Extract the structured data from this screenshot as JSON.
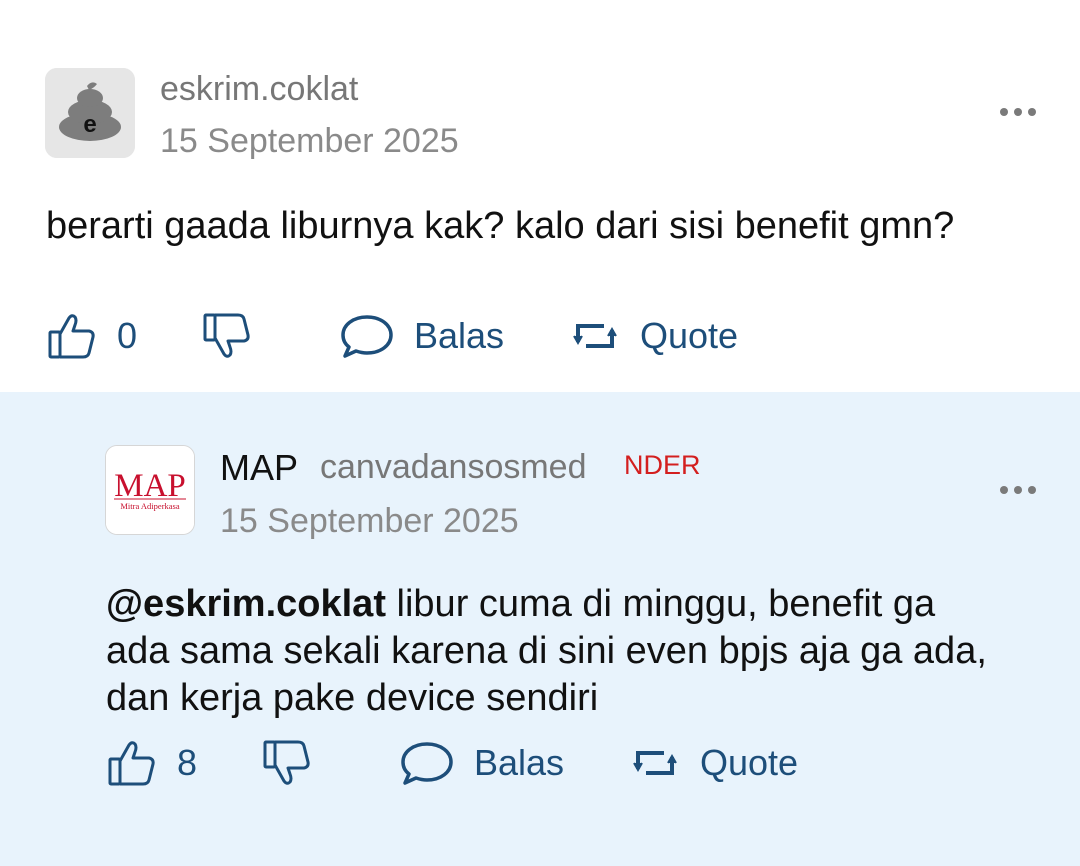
{
  "thread": {
    "posts": [
      {
        "username": "eskrim.coklat",
        "avatar_letter": "e",
        "date": "15 September 2025",
        "text": "berarti gaada liburnya kak? kalo dari sisi benefit gmn?",
        "likes": "0",
        "reply_label": "Balas",
        "quote_label": "Quote"
      },
      {
        "display_name": "MAP",
        "username": "canvadansosmed",
        "badge": "NDER",
        "avatar_logo": "MAP",
        "avatar_sub": "Mitra Adiperkasa",
        "date": "15 September 2025",
        "mention": "@eskrim.coklat",
        "text": " libur cuma di minggu, benefit ga ada sama sekali karena di sini even bpjs aja ga ada, dan kerja pake device sendiri",
        "likes": "8",
        "reply_label": "Balas",
        "quote_label": "Quote"
      }
    ]
  },
  "colors": {
    "reply_background": "#e8f3fc",
    "action_blue": "#1d4e7a",
    "badge_red": "#d31f1f",
    "logo_red": "#c8102e"
  },
  "icons": [
    "thumbs-up-icon",
    "thumbs-down-icon",
    "speech-bubble-icon",
    "repost-icon",
    "more-options-icon"
  ]
}
